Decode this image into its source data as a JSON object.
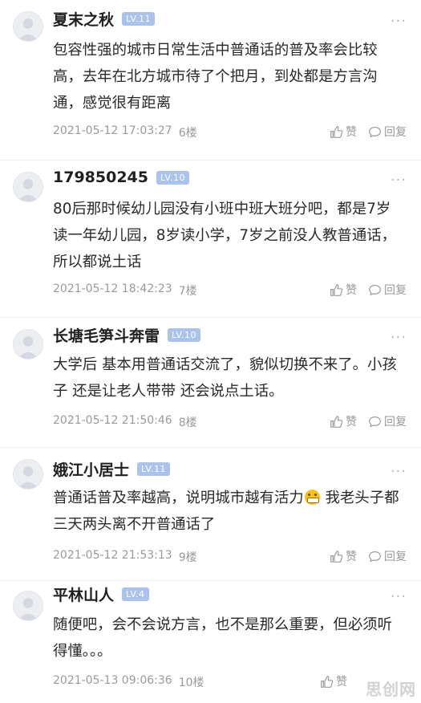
{
  "actions": {
    "like_label": "赞",
    "reply_label": "回复",
    "more_label": "···"
  },
  "comments": [
    {
      "username": "夏末之秋",
      "level": "LV.11",
      "text": "包容性强的城市日常生活中普通话的普及率会比较高，去年在北方城市待了个把月，到处都是方言沟通，感觉很有距离",
      "time": "2021-05-12 17:03:27",
      "floor": "6楼"
    },
    {
      "username": "179850245",
      "level": "LV.10",
      "text": "80后那时候幼儿园没有小班中班大班分吧，都是7岁读一年幼儿园，8岁读小学，7岁之前没人教普通话，所以都说土话",
      "time": "2021-05-12 18:42:23",
      "floor": "7楼"
    },
    {
      "username": "长塘毛笋斗奔雷",
      "level": "LV.10",
      "text": "大学后 基本用普通话交流了，貌似切换不来了。小孩子 还是让老人带带 还会说点土话。",
      "time": "2021-05-12 21:50:46",
      "floor": "8楼"
    },
    {
      "username": "娥江小居士",
      "level": "LV.11",
      "text_before": "普通话普及率越高，说明城市越有活力",
      "emoji": "grinning-face-emoji",
      "text_after": " 我老头子都三天两头离不开普通话了",
      "time": "2021-05-12 21:53:13",
      "floor": "9楼"
    },
    {
      "username": "平林山人",
      "level": "LV.4",
      "text": "随便吧，会不会说方言，也不是那么重要，但必须听得懂。。。",
      "time": "2021-05-13 09:06:36",
      "floor": "10楼"
    }
  ],
  "watermark": "思创网",
  "colors": {
    "level_badge": "#a9c3ec",
    "meta_text": "#9a9a9a",
    "divider": "#eeeeee"
  }
}
